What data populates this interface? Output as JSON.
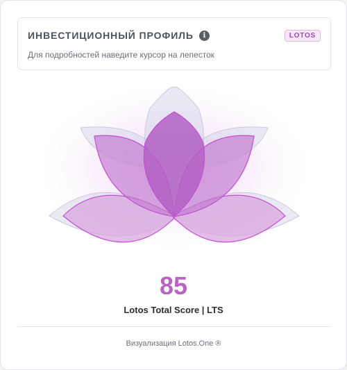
{
  "header": {
    "title": "Инвестиционный профиль",
    "badge": "LOTOS",
    "hint": "Для подробностей наведите курсор на лепесток"
  },
  "score": {
    "value": "85",
    "label": "Lotos Total Score | LTS"
  },
  "footer": {
    "text": "Визуализация Lotos.One ®"
  },
  "colors": {
    "accent": "#b865c2",
    "petal_outline": "#c44fd4",
    "petal_fill": "#b060c8",
    "shadow_petal": "#d8d8ea"
  }
}
